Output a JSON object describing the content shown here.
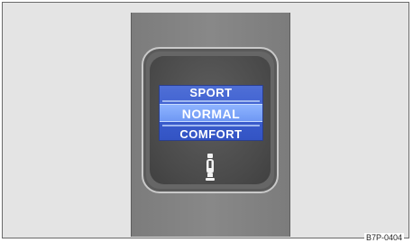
{
  "drive_mode_selector": {
    "modes": [
      {
        "label": "SPORT",
        "selected": false
      },
      {
        "label": "NORMAL",
        "selected": true
      },
      {
        "label": "COMFORT",
        "selected": false
      }
    ],
    "icon": "shock-absorber-icon"
  },
  "figure_code": "B7P-0404",
  "colors": {
    "display_blue": "#3d5fd0",
    "selected_highlight": "#7fa6fa",
    "panel_gray": "#7c7c7c"
  }
}
